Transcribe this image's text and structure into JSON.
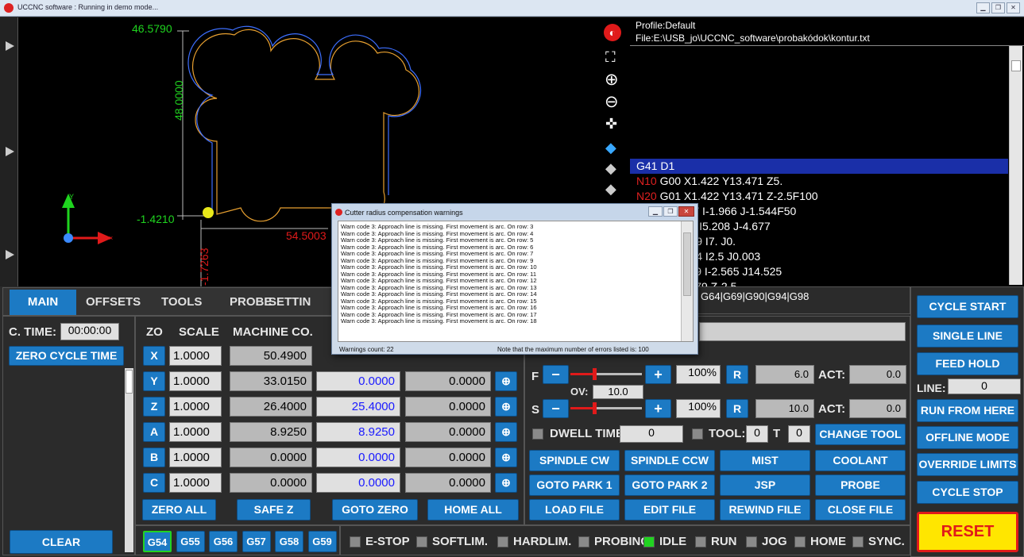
{
  "window": {
    "title": "UCCNC software : Running in demo mode..."
  },
  "view": {
    "ymax": "46.5790",
    "ydim": "48.0000",
    "ymin": "-1.4210",
    "xdim": "54.5003",
    "xmin": "-1.7263"
  },
  "code": {
    "profile": "Profile:Default",
    "file": "File:E:\\USB_jo\\UCCNC_software\\probakódok\\kontur.txt",
    "lines": [
      {
        "n": "",
        "t": "G41 D1"
      },
      {
        "n": "N10",
        "t": " G00 X1.422 Y13.471 Z5."
      },
      {
        "n": "N20",
        "t": " G01 X1.422 Y13.471 Z-2.5F100"
      },
      {
        "n": "",
        "t": "316 Y10.257 I-1.966 J-1.544F50"
      },
      {
        "n": "",
        "t": ".476 Y5.579 I5.208 J-4.677"
      },
      {
        "n": "",
        "t": "3.524 Y5.589 I7. J0."
      },
      {
        "n": "",
        "t": "5.589 Y8.054 I2.5 J0.003"
      },
      {
        "n": "",
        "t": "2.26 Y11.079 I-2.565 J14.525"
      },
      {
        "n": "",
        "t": "3.787 Y11.079 Z-2.5"
      }
    ],
    "gcodes": "G64|G69|G90|G94|G98"
  },
  "tabs": [
    "MAIN",
    "OFFSETS",
    "TOOLS",
    "PROBE",
    "SETTIN"
  ],
  "left": {
    "ctime_label": "C. TIME:",
    "ctime": "00:00:00",
    "zero_cycle": "ZERO CYCLE TIME",
    "clear": "CLEAR"
  },
  "axes_header": {
    "zo": "ZO",
    "scale": "SCALE",
    "machine": "MACHINE CO."
  },
  "axes": [
    {
      "name": "X",
      "scale": "1.0000",
      "machine": "50.4900",
      "work": "",
      "offset": ""
    },
    {
      "name": "Y",
      "scale": "1.0000",
      "machine": "33.0150",
      "work": "0.0000",
      "offset": "0.0000"
    },
    {
      "name": "Z",
      "scale": "1.0000",
      "machine": "26.4000",
      "work": "25.4000",
      "offset": "0.0000"
    },
    {
      "name": "A",
      "scale": "1.0000",
      "machine": "8.9250",
      "work": "8.9250",
      "offset": "0.0000"
    },
    {
      "name": "B",
      "scale": "1.0000",
      "machine": "0.0000",
      "work": "0.0000",
      "offset": "0.0000"
    },
    {
      "name": "C",
      "scale": "1.0000",
      "machine": "0.0000",
      "work": "0.0000",
      "offset": "0.0000"
    }
  ],
  "axis_btns": {
    "zero_all": "ZERO ALL",
    "safe_z": "SAFE Z",
    "goto_zero": "GOTO ZERO",
    "home_all": "HOME ALL"
  },
  "work_offsets": [
    "G54",
    "G55",
    "G56",
    "G57",
    "G58",
    "G59"
  ],
  "feed": {
    "f": "F",
    "minus": "−",
    "plus": "+",
    "pct": "100%",
    "r": "R",
    "val": "6.0",
    "act_label": "ACT:",
    "act": "0.0",
    "ov_label": "OV:",
    "ov": "10.0"
  },
  "spindle": {
    "s": "S",
    "minus": "−",
    "plus": "+",
    "pct": "100%",
    "r": "R",
    "val": "10.0",
    "act_label": "ACT:",
    "act": "0.0"
  },
  "dwell": {
    "label": "DWELL TIME:",
    "val": "0",
    "tool_label": "TOOL:",
    "tool": "0",
    "t_label": "T",
    "t": "0",
    "change_tool": "CHANGE TOOL"
  },
  "grid_btns": [
    "SPINDLE CW",
    "SPINDLE CCW",
    "MIST",
    "COOLANT",
    "GOTO PARK 1",
    "GOTO PARK 2",
    "JSP",
    "PROBE",
    "LOAD FILE",
    "EDIT FILE",
    "REWIND FILE",
    "CLOSE FILE"
  ],
  "status": [
    "E-STOP",
    "SOFTLIM.",
    "HARDLIM.",
    "PROBING",
    "IDLE",
    "RUN",
    "JOG",
    "HOME",
    "SYNC."
  ],
  "right": {
    "cycle_start": "CYCLE START",
    "single_line": "SINGLE LINE",
    "feed_hold": "FEED HOLD",
    "line_label": "LINE:",
    "line": "0",
    "run_from_here": "RUN FROM HERE",
    "offline": "OFFLINE MODE",
    "override": "OVERRIDE LIMITS",
    "cycle_stop": "CYCLE STOP",
    "reset": "RESET"
  },
  "dialog": {
    "title": "Cutter radius compensation warnings",
    "rows": [
      "3",
      "4",
      "5",
      "6",
      "7",
      "9",
      "10",
      "11",
      "12",
      "13",
      "14",
      "15",
      "16",
      "17",
      "18"
    ],
    "row_prefix": "Warn code 3: Approach line is missing. First movement is arc. On row: ",
    "count": "Warnings count:  22",
    "note": "Note that the maximum number of errors listed is:  100"
  },
  "colors": {
    "accent": "#1c7ac4",
    "reset": "#ffe600",
    "idle_led": "#21d321"
  }
}
